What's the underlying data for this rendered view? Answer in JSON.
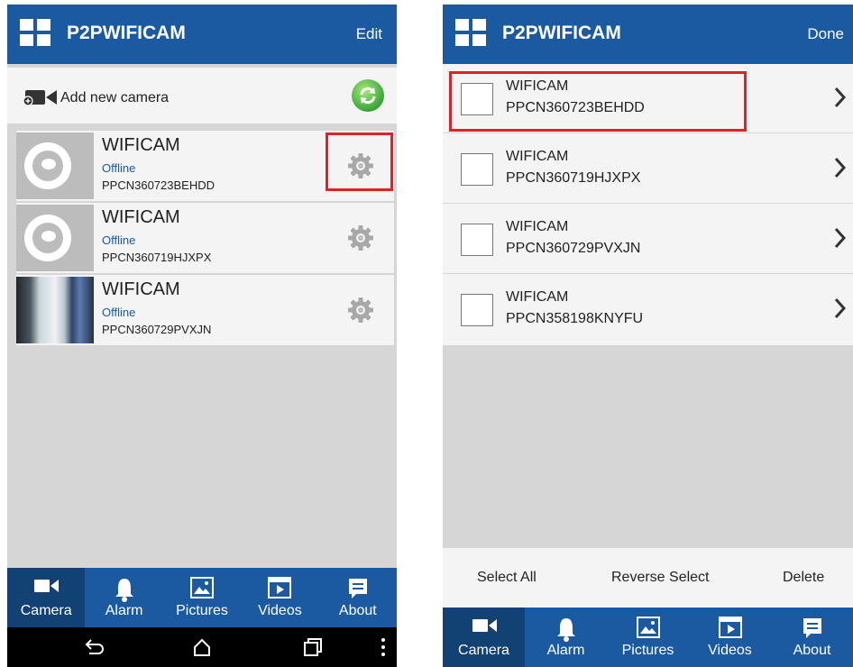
{
  "left": {
    "app_title": "P2PWIFICAM",
    "header_action": "Edit",
    "add_camera_label": "Add new camera",
    "cameras": [
      {
        "name": "WIFICAM",
        "status": "Offline",
        "uid": "PPCN360723BEHDD",
        "thumb": "lens-icon"
      },
      {
        "name": "WIFICAM",
        "status": "Offline",
        "uid": "PPCN360719HJXPX",
        "thumb": "lens-icon"
      },
      {
        "name": "WIFICAM",
        "status": "Offline",
        "uid": "PPCN360729PVXJN",
        "thumb": "photo"
      }
    ],
    "tabs": [
      {
        "label": "Camera",
        "icon": "camera-icon",
        "active": true
      },
      {
        "label": "Alarm",
        "icon": "bell-icon",
        "active": false
      },
      {
        "label": "Pictures",
        "icon": "picture-icon",
        "active": false
      },
      {
        "label": "Videos",
        "icon": "film-icon",
        "active": false
      },
      {
        "label": "About",
        "icon": "message-icon",
        "active": false
      }
    ],
    "nav_icons": [
      "back-icon",
      "home-icon",
      "recents-icon",
      "more-icon"
    ]
  },
  "right": {
    "app_title": "P2PWIFICAM",
    "header_action": "Done",
    "cameras": [
      {
        "name": "WIFICAM",
        "uid": "PPCN360723BEHDD"
      },
      {
        "name": "WIFICAM",
        "uid": "PPCN360719HJXPX"
      },
      {
        "name": "WIFICAM",
        "uid": "PPCN360729PVXJN"
      },
      {
        "name": "WIFICAM",
        "uid": "PPCN358198KNYFU"
      }
    ],
    "actions": {
      "select_all": "Select All",
      "reverse_select": "Reverse Select",
      "delete": "Delete"
    },
    "tabs": [
      {
        "label": "Camera",
        "icon": "camera-icon",
        "active": true
      },
      {
        "label": "Alarm",
        "icon": "bell-icon",
        "active": false
      },
      {
        "label": "Pictures",
        "icon": "picture-icon",
        "active": false
      },
      {
        "label": "Videos",
        "icon": "film-icon",
        "active": false
      },
      {
        "label": "About",
        "icon": "message-icon",
        "active": false
      }
    ]
  },
  "colors": {
    "brand": "#1b5aa0",
    "brand_dark": "#124173",
    "highlight": "#e3202a",
    "status": "#1b5aa0"
  }
}
